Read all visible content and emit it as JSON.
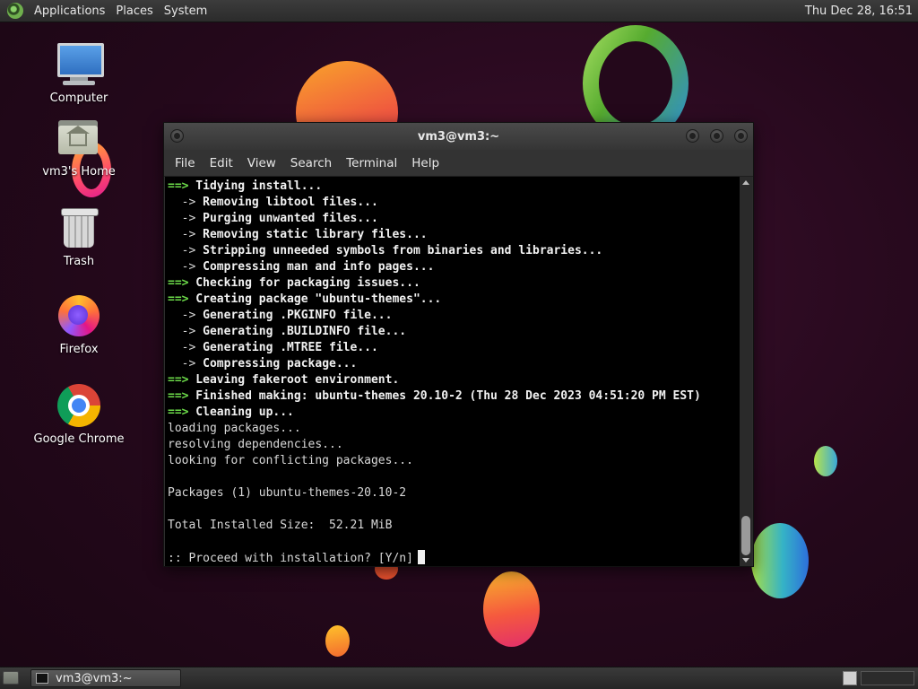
{
  "top_panel": {
    "menus": [
      "Applications",
      "Places",
      "System"
    ],
    "clock": "Thu Dec 28, 16:51"
  },
  "desktop_icons": [
    {
      "label": "Computer",
      "icon": "computer-icon"
    },
    {
      "label": "vm3's Home",
      "icon": "home-folder-icon"
    },
    {
      "label": "Trash",
      "icon": "trash-icon"
    },
    {
      "label": "Firefox",
      "icon": "firefox-icon"
    },
    {
      "label": "Google Chrome",
      "icon": "chrome-icon"
    }
  ],
  "terminal": {
    "title": "vm3@vm3:~",
    "menu": [
      "File",
      "Edit",
      "View",
      "Search",
      "Terminal",
      "Help"
    ],
    "lines": [
      {
        "prefix": "==>",
        "text": " Tidying install...",
        "style": "major"
      },
      {
        "prefix": "  ->",
        "text": " Removing libtool files...",
        "style": "minor"
      },
      {
        "prefix": "  ->",
        "text": " Purging unwanted files...",
        "style": "minor"
      },
      {
        "prefix": "  ->",
        "text": " Removing static library files...",
        "style": "minor"
      },
      {
        "prefix": "  ->",
        "text": " Stripping unneeded symbols from binaries and libraries...",
        "style": "minor"
      },
      {
        "prefix": "  ->",
        "text": " Compressing man and info pages...",
        "style": "minor"
      },
      {
        "prefix": "==>",
        "text": " Checking for packaging issues...",
        "style": "major"
      },
      {
        "prefix": "==>",
        "text": " Creating package \"ubuntu-themes\"...",
        "style": "major"
      },
      {
        "prefix": "  ->",
        "text": " Generating .PKGINFO file...",
        "style": "minor"
      },
      {
        "prefix": "  ->",
        "text": " Generating .BUILDINFO file...",
        "style": "minor"
      },
      {
        "prefix": "  ->",
        "text": " Generating .MTREE file...",
        "style": "minor"
      },
      {
        "prefix": "  ->",
        "text": " Compressing package...",
        "style": "minor"
      },
      {
        "prefix": "==>",
        "text": " Leaving fakeroot environment.",
        "style": "major"
      },
      {
        "prefix": "==>",
        "text": " Finished making: ubuntu-themes 20.10-2 (Thu 28 Dec 2023 04:51:20 PM EST)",
        "style": "major"
      },
      {
        "prefix": "==>",
        "text": " Cleaning up...",
        "style": "major"
      },
      {
        "prefix": "",
        "text": "loading packages...",
        "style": "plain"
      },
      {
        "prefix": "",
        "text": "resolving dependencies...",
        "style": "plain"
      },
      {
        "prefix": "",
        "text": "looking for conflicting packages...",
        "style": "plain"
      },
      {
        "prefix": "",
        "text": "",
        "style": "plain"
      },
      {
        "prefix": "",
        "text": "Packages (1) ubuntu-themes-20.10-2",
        "style": "plain"
      },
      {
        "prefix": "",
        "text": "",
        "style": "plain"
      },
      {
        "prefix": "",
        "text": "Total Installed Size:  52.21 MiB",
        "style": "plain"
      },
      {
        "prefix": "",
        "text": "",
        "style": "plain"
      }
    ],
    "prompt": ":: Proceed with installation? [Y/n]"
  },
  "taskbar": {
    "window_button_label": "vm3@vm3:~"
  },
  "colors": {
    "prompt_green": "#6ddc4a",
    "terminal_bg": "#000000",
    "wallpaper": "#24081b"
  }
}
